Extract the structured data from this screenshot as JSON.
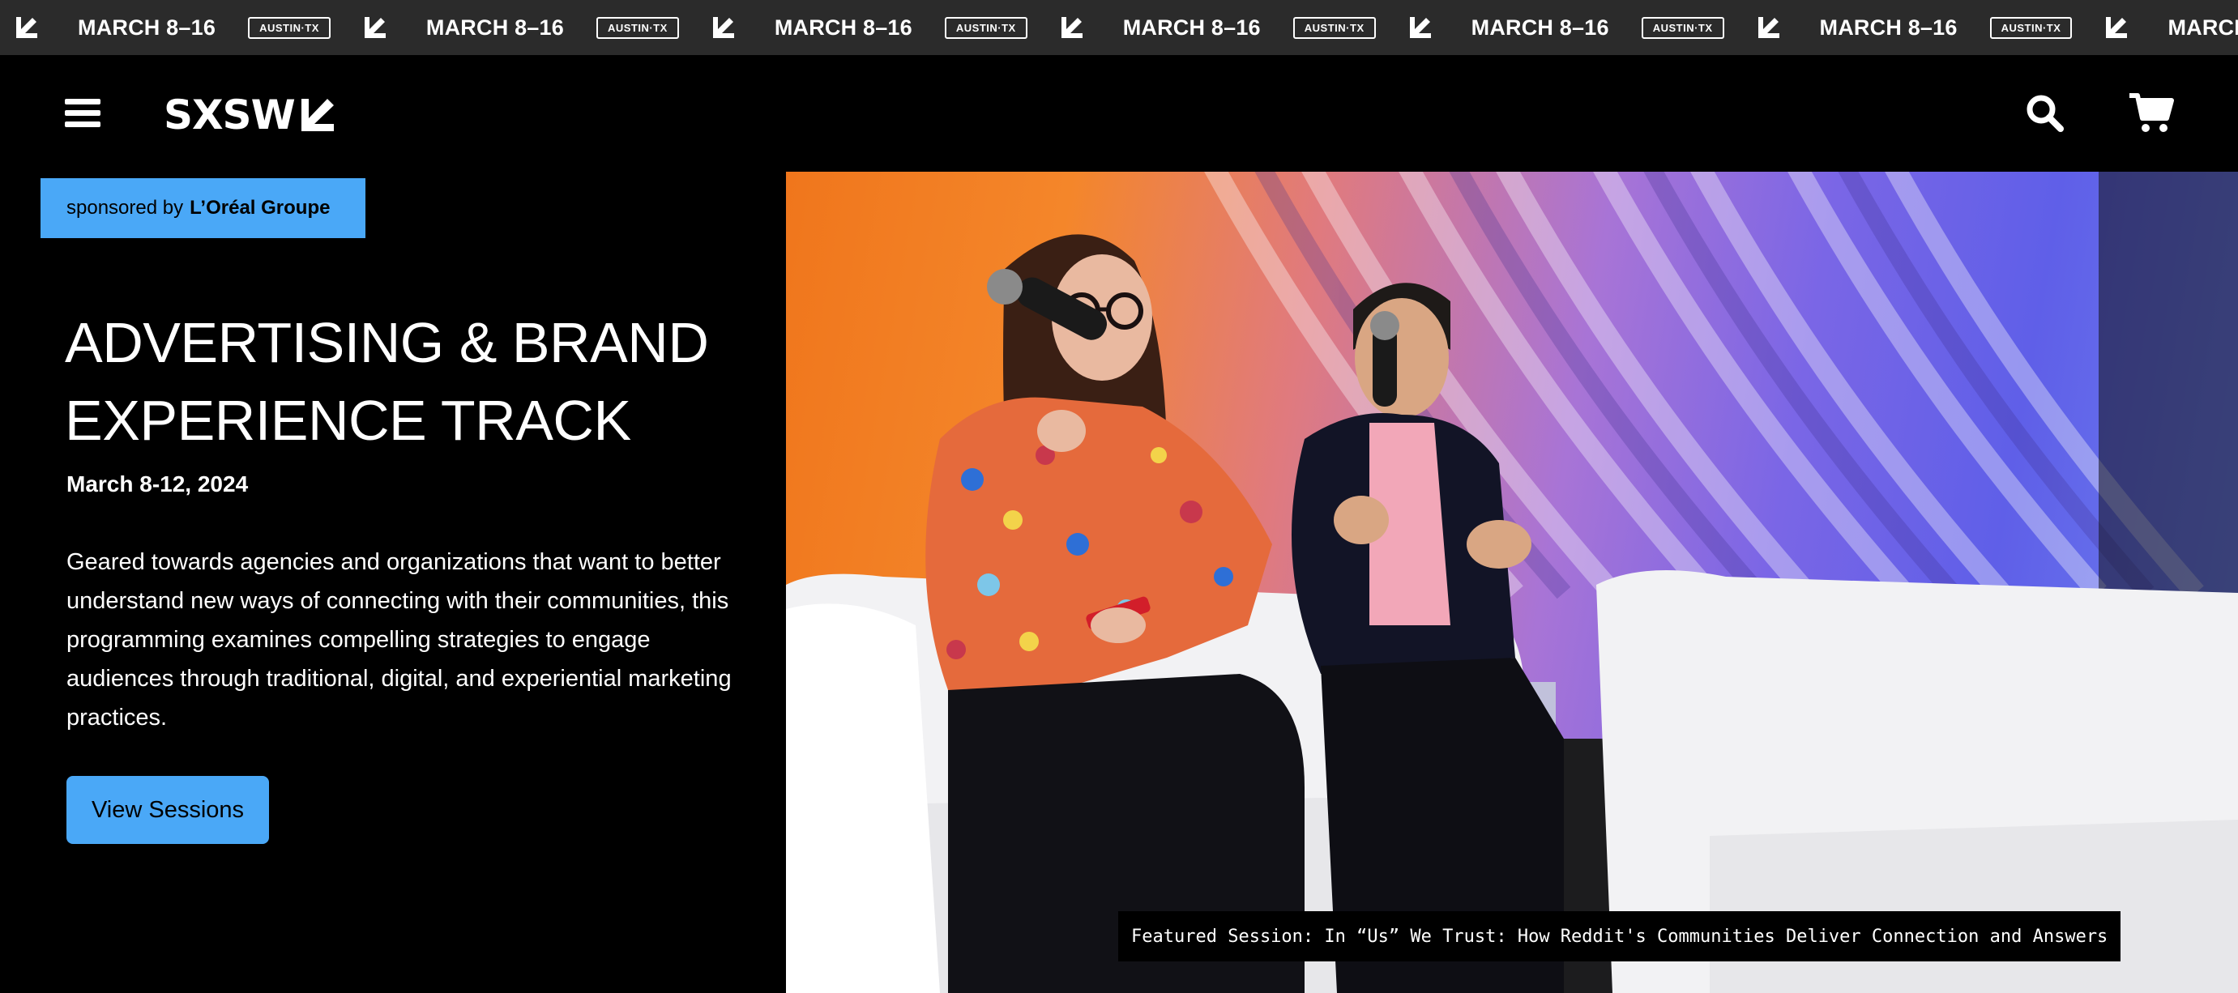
{
  "ticker": {
    "date": "MARCH 8–16",
    "badge": "AUSTIN·TX"
  },
  "header": {
    "logo": "SXSW",
    "menu_icon": "hamburger-menu-icon",
    "search_icon": "search-icon",
    "cart_icon": "shopping-cart-icon"
  },
  "sponsor": {
    "prefix": "sponsored by",
    "name": "L’Oréal Groupe"
  },
  "hero": {
    "title": "ADVERTISING & BRAND EXPERIENCE TRACK",
    "date": "March 8-12, 2024",
    "description": "Geared towards agencies and organizations that want to better understand new ways of connecting with their communities, this programming examines compelling strategies to engage audiences through traditional, digital, and experiential marketing practices.",
    "cta": "View Sessions",
    "caption": "Featured Session: In “Us” We Trust: How Reddit's Communities Deliver Connection and Answers"
  },
  "colors": {
    "accent": "#4aa8f7",
    "background": "#000000",
    "ticker_bg": "#2b2b2b"
  }
}
